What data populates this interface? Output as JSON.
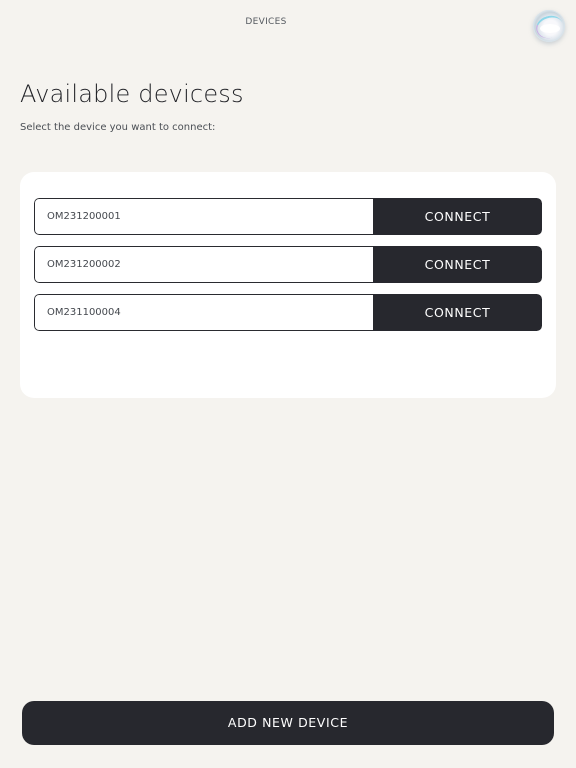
{
  "header": {
    "title": "DEVICES",
    "avatar_icon": "orb-logo-icon"
  },
  "main": {
    "heading": "Available devicess",
    "subtitle": "Select the device you want to connect:",
    "devices": [
      {
        "serial": "OM231200001",
        "action": "CONNECT"
      },
      {
        "serial": "OM231200002",
        "action": "CONNECT"
      },
      {
        "serial": "OM231100004",
        "action": "CONNECT"
      }
    ]
  },
  "footer": {
    "add_label": "ADD NEW DEVICE"
  },
  "colors": {
    "background": "#f5f3ef",
    "card": "#ffffff",
    "button": "#27282e",
    "button_text": "#ffffff"
  }
}
